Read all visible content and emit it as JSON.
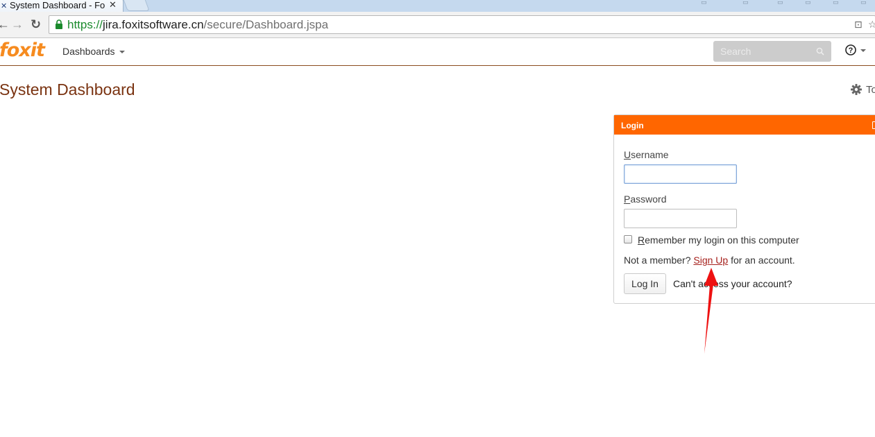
{
  "browser": {
    "tab_title": "System Dashboard - Fo",
    "tab_close": "✕",
    "tab_favicon": "✕",
    "url_scheme": "https://",
    "url_host": "jira.foxitsoftware.cn",
    "url_path": "/secure/Dashboard.jspa",
    "back": "←",
    "forward": "→",
    "reload": "↻",
    "translate_icon": "⊡",
    "star_icon": "☆"
  },
  "header": {
    "logo": "foxit",
    "nav_dashboards": "Dashboards",
    "search_placeholder": "Search",
    "help": "?"
  },
  "page": {
    "title": "System Dashboard",
    "tools_label": "To"
  },
  "login_gadget": {
    "title": "Login",
    "username_label_first": "U",
    "username_label_rest": "sername",
    "username_value": "",
    "password_label_first": "P",
    "password_label_rest": "assword",
    "password_value": "",
    "remember_first": "R",
    "remember_rest": "emember my login on this computer",
    "remember_checked": false,
    "not_member_prefix": "Not a member?",
    "sign_up": "Sign Up",
    "not_member_suffix": "for an account.",
    "login_button": "Log In",
    "cant_access": "Can't access your account?"
  },
  "colors": {
    "gadget_header": "#ff6600",
    "title_brown": "#7a3311",
    "logo_orange": "#f68b1f",
    "annotation_arrow": "#ee1111"
  }
}
